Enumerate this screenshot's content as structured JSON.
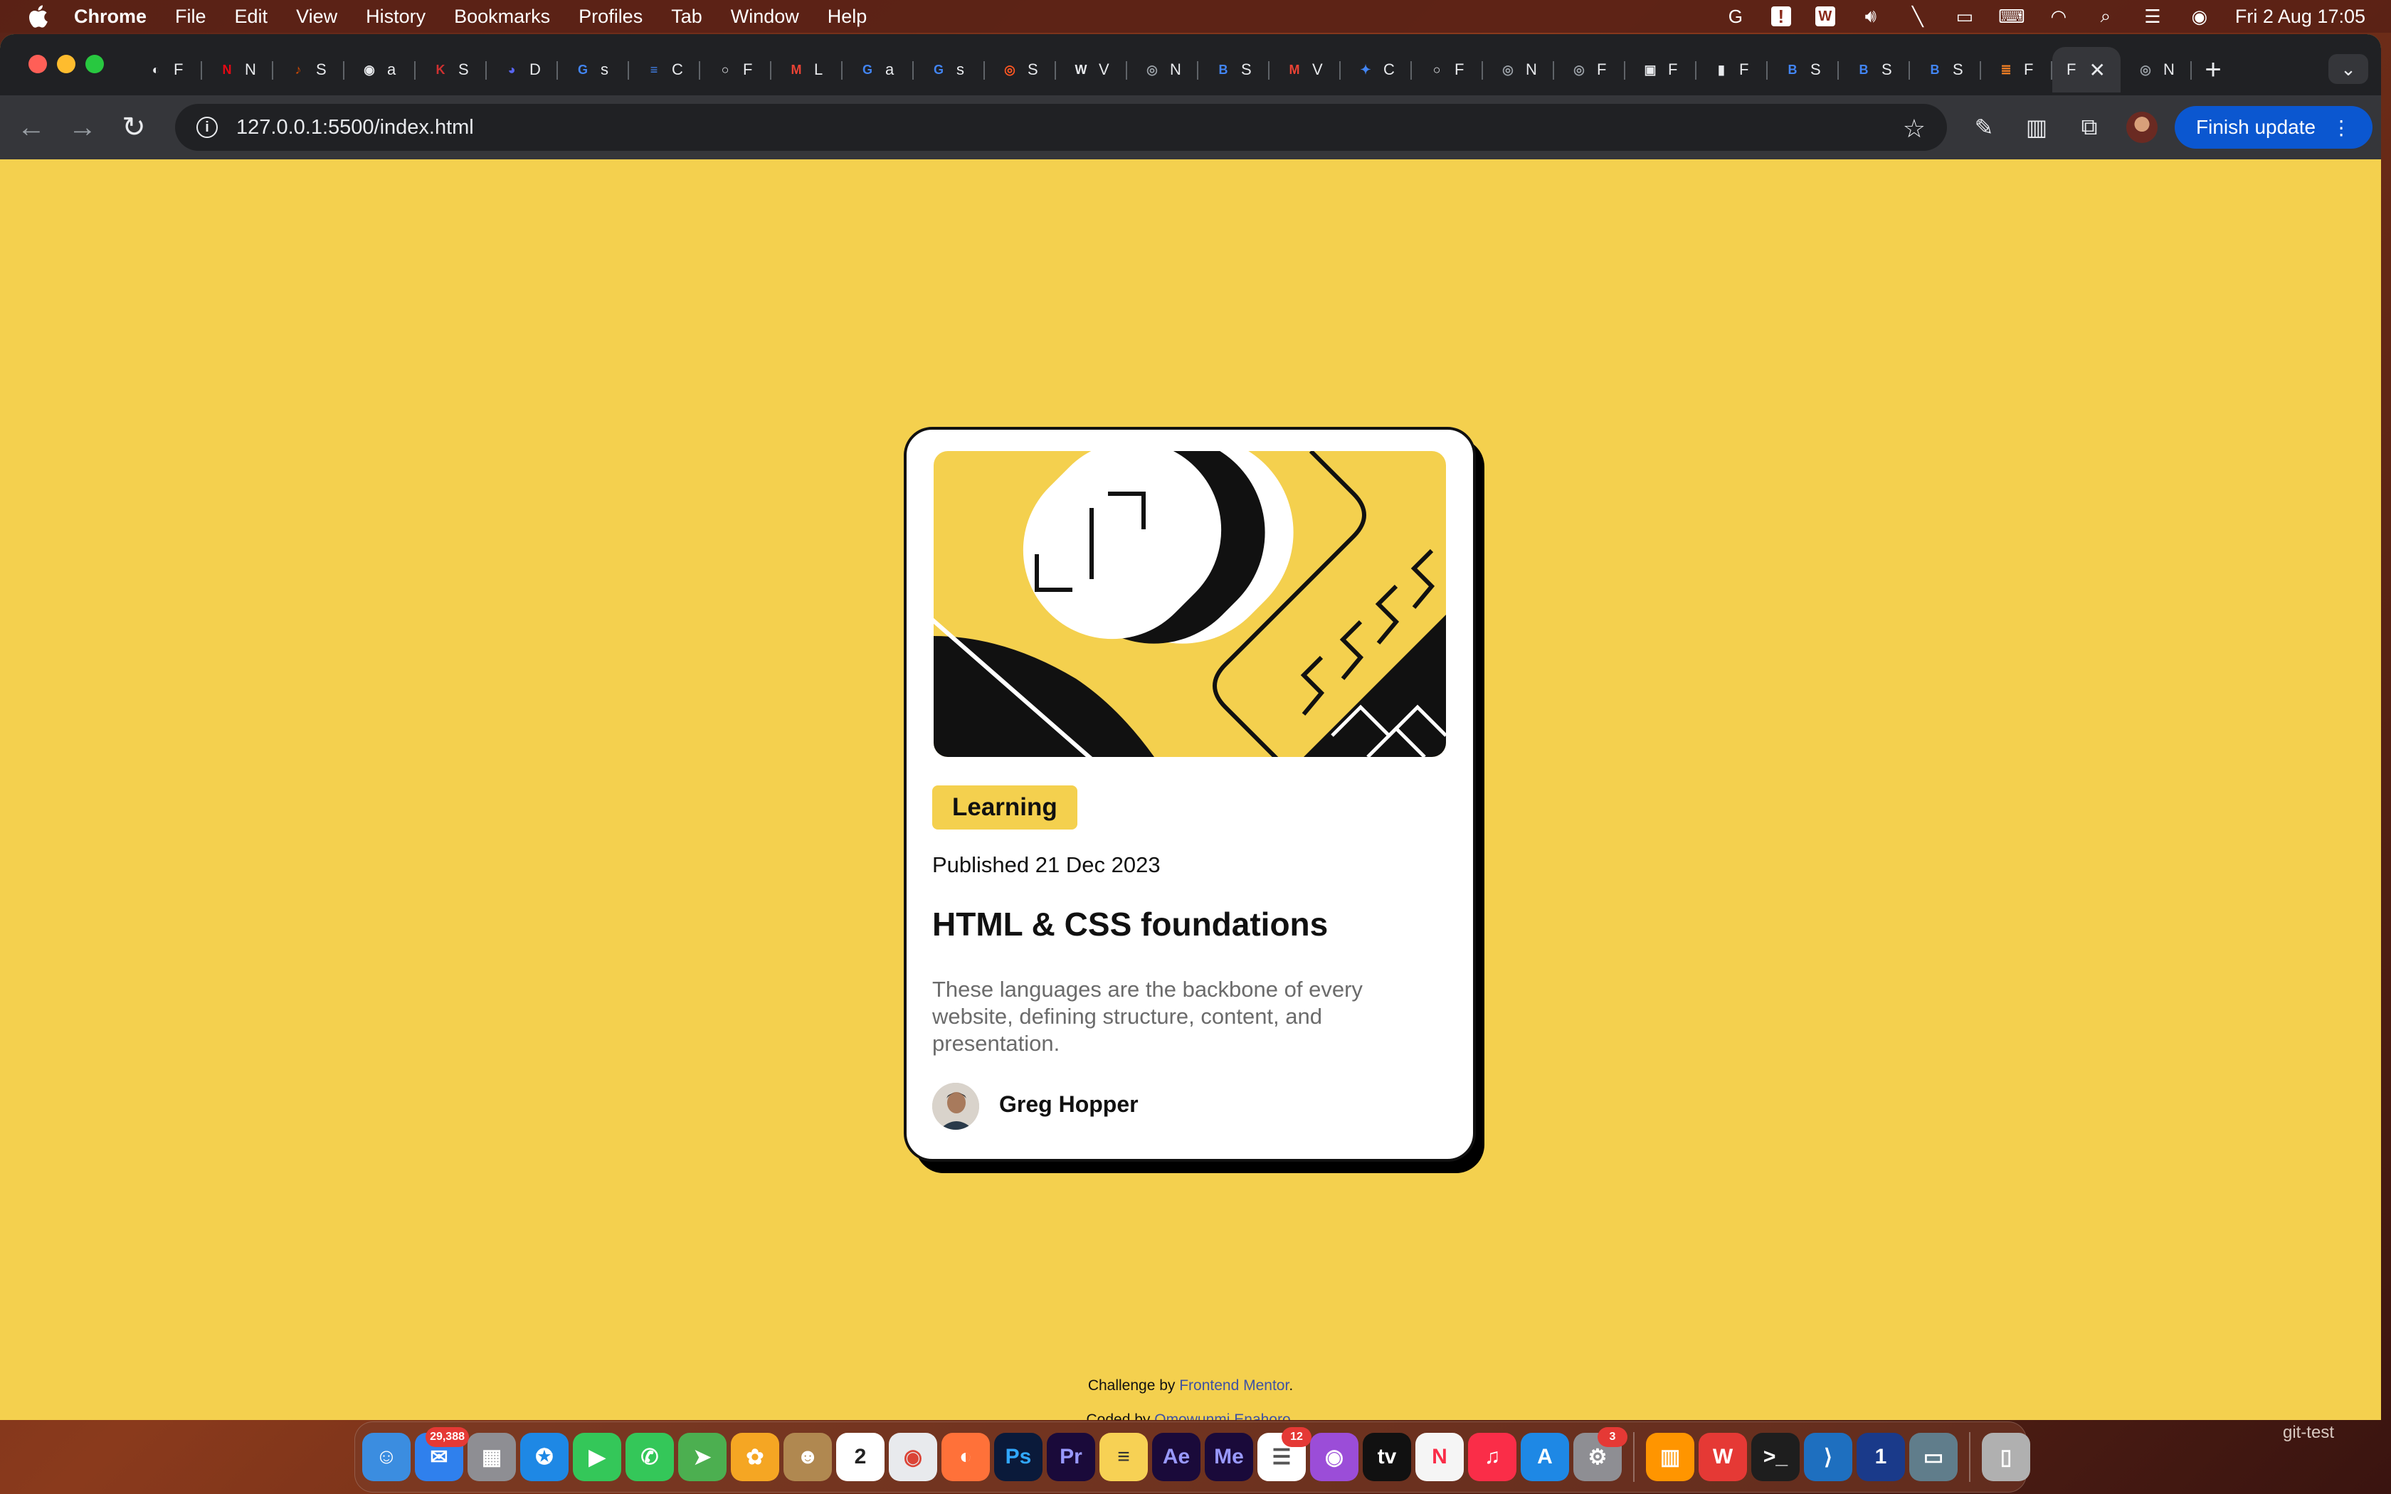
{
  "menubar": {
    "app_name": "Chrome",
    "items": [
      "File",
      "Edit",
      "View",
      "History",
      "Bookmarks",
      "Profiles",
      "Tab",
      "Window",
      "Help"
    ],
    "status_icons": [
      "grammarly-icon",
      "alert-icon",
      "word-icon",
      "volume-icon",
      "pen-icon",
      "battery-icon",
      "keyboard-icon",
      "wifi-icon",
      "spotlight-icon",
      "control-center-icon",
      "siri-icon"
    ],
    "clock": "Fri 2 Aug  17:05"
  },
  "browser": {
    "tabs": [
      {
        "title": "F",
        "color": "#e8eaed",
        "glyph": "◐"
      },
      {
        "title": "N",
        "color": "#e50914",
        "glyph": "N"
      },
      {
        "title": "S",
        "color": "#d04a02",
        "glyph": "♪"
      },
      {
        "title": "a",
        "color": "#e8eaed",
        "glyph": "◉"
      },
      {
        "title": "S",
        "color": "#d03030",
        "glyph": "K"
      },
      {
        "title": "D",
        "color": "#5865f2",
        "glyph": "◕"
      },
      {
        "title": "s",
        "color": "#4285f4",
        "glyph": "G"
      },
      {
        "title": "C",
        "color": "#4285f4",
        "glyph": "≡"
      },
      {
        "title": "F",
        "color": "#e8eaed",
        "glyph": "○"
      },
      {
        "title": "L",
        "color": "#ea4335",
        "glyph": "M"
      },
      {
        "title": "a",
        "color": "#4285f4",
        "glyph": "G"
      },
      {
        "title": "s",
        "color": "#4285f4",
        "glyph": "G"
      },
      {
        "title": "S",
        "color": "#ff5722",
        "glyph": "◎"
      },
      {
        "title": "V",
        "color": "#e8eaed",
        "glyph": "W"
      },
      {
        "title": "N",
        "color": "#9aa0a6",
        "glyph": "◎"
      },
      {
        "title": "S",
        "color": "#4285f4",
        "glyph": "B"
      },
      {
        "title": "V",
        "color": "#ea4335",
        "glyph": "M"
      },
      {
        "title": "C",
        "color": "#4285f4",
        "glyph": "✦"
      },
      {
        "title": "F",
        "color": "#e8eaed",
        "glyph": "○"
      },
      {
        "title": "N",
        "color": "#9aa0a6",
        "glyph": "◎"
      },
      {
        "title": "F",
        "color": "#9aa0a6",
        "glyph": "◎"
      },
      {
        "title": "F",
        "color": "#e8eaed",
        "glyph": "▣"
      },
      {
        "title": "F",
        "color": "#e8eaed",
        "glyph": "▮"
      },
      {
        "title": "S",
        "color": "#4285f4",
        "glyph": "B"
      },
      {
        "title": "S",
        "color": "#4285f4",
        "glyph": "B"
      },
      {
        "title": "S",
        "color": "#4285f4",
        "glyph": "B"
      },
      {
        "title": "F",
        "color": "#f48024",
        "glyph": "≣"
      }
    ],
    "active_tab": {
      "title": "F",
      "close": "✕"
    },
    "after_tabs": [
      {
        "title": "N",
        "color": "#9aa0a6",
        "glyph": "◎"
      }
    ],
    "new_tab": "+",
    "url": "127.0.0.1:5500/index.html",
    "finish_update": "Finish update"
  },
  "card": {
    "tag": "Learning",
    "published": "Published 21 Dec 2023",
    "title": "HTML & CSS foundations",
    "description": "These languages are the backbone of every website, defining structure, content, and presentation.",
    "author": "Greg Hopper"
  },
  "attribution": {
    "challenge_prefix": "Challenge by ",
    "challenge_link": "Frontend Mentor",
    "coded_prefix": "Coded by ",
    "coded_link": "Omowunmi Enahoro",
    "period": "."
  },
  "dock": {
    "apps": [
      {
        "name": "finder",
        "bg": "#3b8de0",
        "glyph": "☺"
      },
      {
        "name": "mail",
        "bg": "#2f80ed",
        "glyph": "✉",
        "badge": "29,388"
      },
      {
        "name": "launchpad",
        "bg": "#8e8e93",
        "glyph": "▦"
      },
      {
        "name": "safari",
        "bg": "#1e88e5",
        "glyph": "✪"
      },
      {
        "name": "facetime",
        "bg": "#34c759",
        "glyph": "▶"
      },
      {
        "name": "messages",
        "bg": "#34c759",
        "glyph": "✆"
      },
      {
        "name": "maps",
        "bg": "#4caf50",
        "glyph": "➤"
      },
      {
        "name": "photos",
        "bg": "#f5a623",
        "glyph": "✿"
      },
      {
        "name": "contacts",
        "bg": "#b08850",
        "glyph": "☻"
      },
      {
        "name": "calendar",
        "bg": "#ffffff",
        "glyph": "2",
        "fg": "#222"
      },
      {
        "name": "chrome",
        "bg": "#e8eaed",
        "glyph": "◉",
        "fg": "#db4437"
      },
      {
        "name": "firefox",
        "bg": "#ff7139",
        "glyph": "◐"
      },
      {
        "name": "photoshop",
        "bg": "#0a1a3a",
        "glyph": "Ps",
        "fg": "#31a8ff"
      },
      {
        "name": "premiere",
        "bg": "#1a0a3a",
        "glyph": "Pr",
        "fg": "#9999ff"
      },
      {
        "name": "notes",
        "bg": "#f7d154",
        "glyph": "≡",
        "fg": "#333"
      },
      {
        "name": "after-effects",
        "bg": "#1a0a3a",
        "glyph": "Ae",
        "fg": "#9999ff"
      },
      {
        "name": "media-encoder",
        "bg": "#1a0a3a",
        "glyph": "Me",
        "fg": "#9999ff"
      },
      {
        "name": "reminders",
        "bg": "#ffffff",
        "glyph": "☰",
        "fg": "#555",
        "badge": "12"
      },
      {
        "name": "podcasts",
        "bg": "#9b4dd8",
        "glyph": "◉"
      },
      {
        "name": "apple-tv",
        "bg": "#111111",
        "glyph": "tv"
      },
      {
        "name": "news",
        "bg": "#f5f5f5",
        "glyph": "N",
        "fg": "#fa2d48"
      },
      {
        "name": "music",
        "bg": "#fa2d48",
        "glyph": "♫"
      },
      {
        "name": "app-store",
        "bg": "#1e88e5",
        "glyph": "A"
      },
      {
        "name": "system-settings",
        "bg": "#8e8e93",
        "glyph": "⚙",
        "badge": "3"
      },
      {
        "name": "books",
        "bg": "#ff9500",
        "glyph": "▥"
      },
      {
        "name": "wps-office",
        "bg": "#e53935",
        "glyph": "W"
      },
      {
        "name": "terminal",
        "bg": "#1e1e1e",
        "glyph": ">_"
      },
      {
        "name": "vscode",
        "bg": "#1e6fbf",
        "glyph": "⟩"
      },
      {
        "name": "1password",
        "bg": "#1a3a8a",
        "glyph": "1"
      },
      {
        "name": "preview",
        "bg": "#607d8b",
        "glyph": "▭"
      }
    ],
    "trash": {
      "name": "trash",
      "bg": "#b0b0b0",
      "glyph": "▯"
    },
    "desktop_label": "git-test"
  }
}
